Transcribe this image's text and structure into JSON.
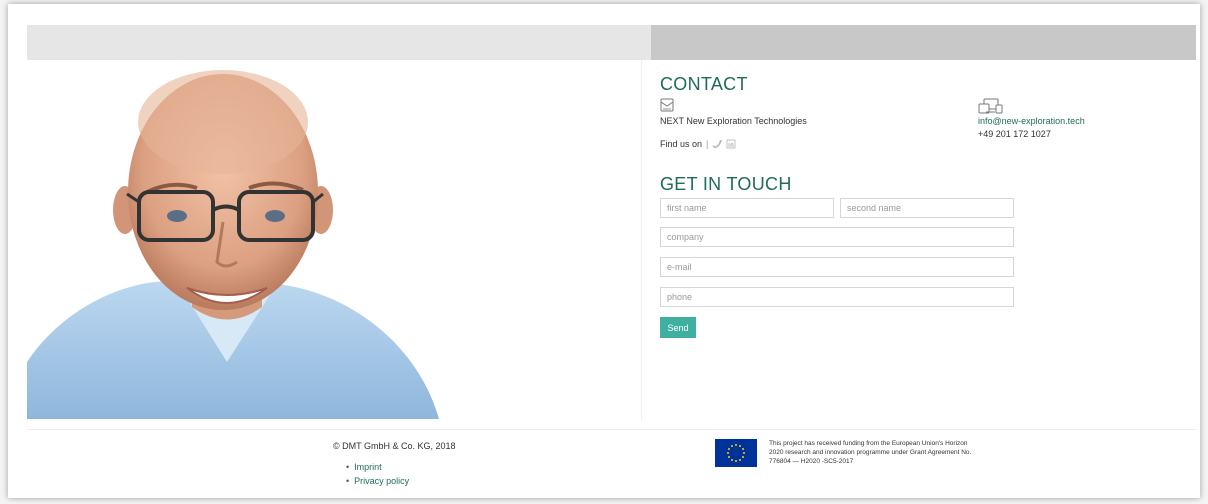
{
  "contact": {
    "heading": "CONTACT",
    "company": "NEXT New Exploration Technologies",
    "find_us": "Find us on",
    "separator": "|",
    "social": [
      "twitter-icon",
      "linkedin-icon"
    ],
    "email": "info@new-exploration.tech",
    "phone": "+49 201 172 1027"
  },
  "form": {
    "heading": "GET IN TOUCH",
    "first_name_placeholder": "first name",
    "second_name_placeholder": "second name",
    "company_placeholder": "company",
    "email_placeholder": "e-mail",
    "phone_placeholder": "phone",
    "send_label": "Send"
  },
  "footer": {
    "copyright": "© DMT GmbH & Co. KG, 2018",
    "links": [
      "Imprint",
      "Privacy policy"
    ],
    "funding_text": "This project has received funding from the European Union's Horizon 2020 research and innovation programme under Grant Agreement No. 776804 — H2020 -SC5-2017"
  },
  "colors": {
    "heading": "#1f6b5c",
    "button": "#3fb0a0",
    "band_left": "#e6e6e6",
    "band_right": "#c8c8c8",
    "eu_blue": "#003399",
    "eu_star": "#ffcc00"
  }
}
